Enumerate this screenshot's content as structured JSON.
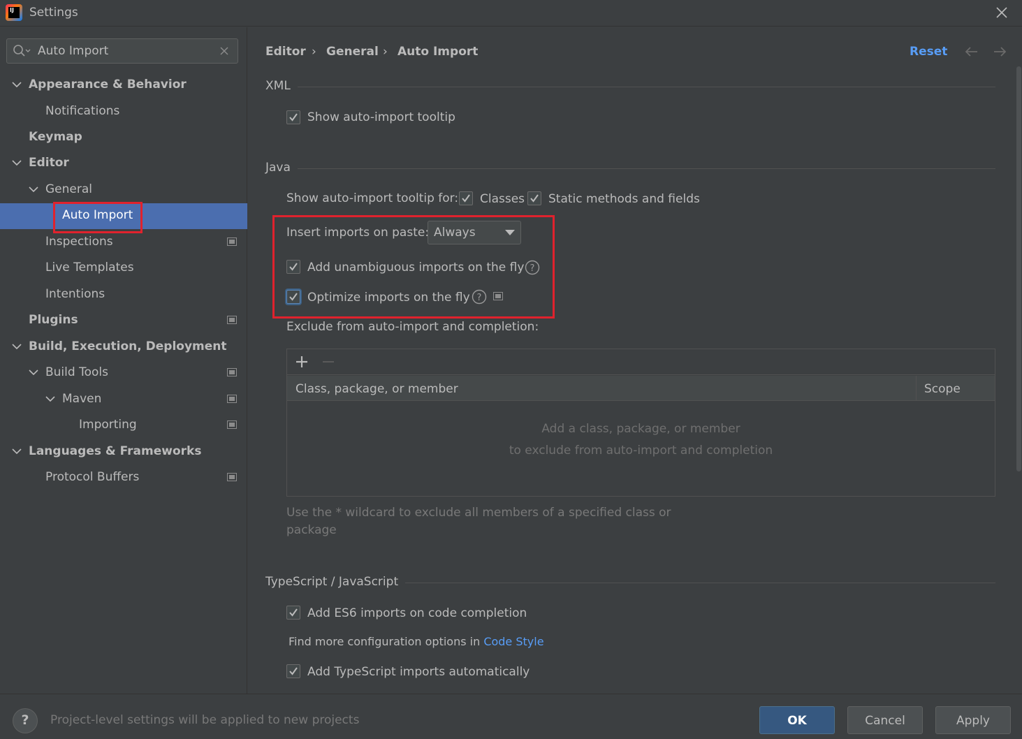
{
  "window": {
    "title": "Settings",
    "app_icon_text": "IJ"
  },
  "search": {
    "value": "Auto Import",
    "placeholder": ""
  },
  "sidebar": {
    "items": [
      {
        "label": "Appearance & Behavior"
      },
      {
        "label": "Notifications"
      },
      {
        "label": "Keymap"
      },
      {
        "label": "Editor"
      },
      {
        "label": "General"
      },
      {
        "label": "Auto Import"
      },
      {
        "label": "Inspections"
      },
      {
        "label": "Live Templates"
      },
      {
        "label": "Intentions"
      },
      {
        "label": "Plugins"
      },
      {
        "label": "Build, Execution, Deployment"
      },
      {
        "label": "Build Tools"
      },
      {
        "label": "Maven"
      },
      {
        "label": "Importing"
      },
      {
        "label": "Languages & Frameworks"
      },
      {
        "label": "Protocol Buffers"
      }
    ],
    "selected": "Auto Import"
  },
  "breadcrumb": {
    "items": [
      "Editor",
      "General",
      "Auto Import"
    ],
    "separator": "›"
  },
  "header": {
    "reset_label": "Reset"
  },
  "xml": {
    "title": "XML",
    "show_tooltip": {
      "label": "Show auto-import tooltip",
      "checked": true
    }
  },
  "java": {
    "title": "Java",
    "tooltip_for_label": "Show auto-import tooltip for:",
    "classes": {
      "label": "Classes",
      "checked": true
    },
    "static_methods": {
      "label": "Static methods and fields",
      "checked": true
    },
    "insert_on_paste": {
      "label": "Insert imports on paste:",
      "value": "Always"
    },
    "add_unambiguous": {
      "label": "Add unambiguous imports on the fly",
      "checked": true
    },
    "optimize_imports": {
      "label": "Optimize imports on the fly",
      "checked": true
    },
    "exclude_label": "Exclude from auto-import and completion:",
    "table": {
      "columns": [
        "Class, package, or member",
        "Scope"
      ],
      "empty_line1": "Add a class, package, or member",
      "empty_line2": "to exclude from auto-import and completion"
    },
    "hint_line1": "Use the * wildcard to exclude all members of a specified class or",
    "hint_line2": "package"
  },
  "typescript": {
    "title": "TypeScript / JavaScript",
    "es6_imports": {
      "label": "Add ES6 imports on code completion",
      "checked": true
    },
    "find_more": "Find more configuration options in",
    "code_style_link": "Code Style",
    "ts_imports": {
      "label": "Add TypeScript imports automatically",
      "checked": true
    }
  },
  "footer": {
    "help_symbol": "?",
    "status": "Project-level settings will be applied to new projects",
    "ok_label": "OK",
    "cancel_label": "Cancel",
    "apply_label": "Apply"
  },
  "colors": {
    "background": "#3c3f41",
    "selection": "#4b6eaf",
    "link": "#589df6",
    "annotation_red": "#e0222d",
    "ok_button": "#365880"
  },
  "icons": {
    "search": "search-icon",
    "clear": "clear-icon",
    "close": "close-icon",
    "expand": "chevron-down-icon",
    "project_scope": "project-scope-icon",
    "help": "question-circle-icon",
    "back": "arrow-left-icon",
    "forward": "arrow-right-icon",
    "add": "plus-icon",
    "remove": "minus-icon"
  }
}
